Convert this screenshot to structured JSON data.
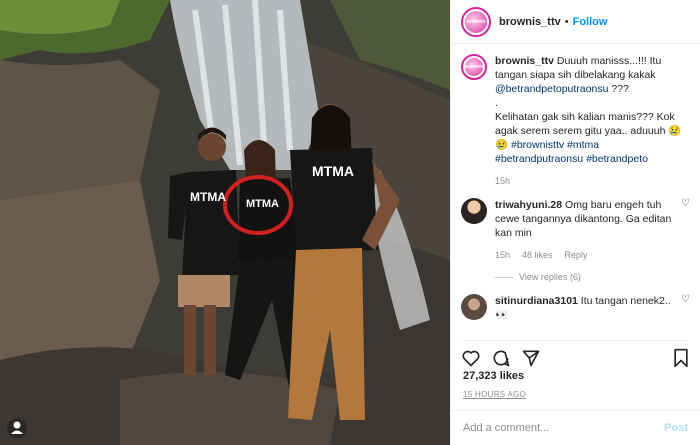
{
  "post": {
    "username": "brownis_ttv",
    "separator": "•",
    "follow_label": "Follow",
    "avatar_text": "brownis"
  },
  "photo": {
    "shirt_text": "MTMA",
    "corner_icon": "user-circle-icon"
  },
  "caption": {
    "username": "brownis_ttv",
    "text_1": " Duuuh manisss...!!! Itu tangan siapa sih dibelakang kakak ",
    "mention": "@betrandpetoputraonsu",
    "text_2": " ???",
    "line_2": ".",
    "text_3": "Kelihatan gak sih kalian manis??? Kok agak serem serem gitu yaa.. aduuuh 😢😢 ",
    "hashtags": "#brownisttv #mtma #betrandputraonsu #betrandpeto",
    "time": "15h"
  },
  "comments": [
    {
      "username": "triwahyuni.28",
      "text": " Omg baru engeh tuh cewe tangannya dikantong. Ga editan kan min",
      "time": "15h",
      "likes": "48 likes",
      "reply": "Reply",
      "view_replies": "View replies (6)"
    },
    {
      "username": "sitinurdiana3101",
      "text": " Itu tangan nenek2.. 👀"
    }
  ],
  "actions": {
    "like_icon": "heart-icon",
    "comment_icon": "comment-icon",
    "share_icon": "share-icon",
    "save_icon": "bookmark-icon"
  },
  "likes_count": "27,323 likes",
  "timestamp": "15 HOURS AGO",
  "add_comment": {
    "placeholder": "Add a comment...",
    "post_label": "Post"
  },
  "colors": {
    "link": "#00376b",
    "follow": "#0095f6",
    "post_disabled": "#b2dffc",
    "circle_annotation": "#d21f1f"
  }
}
